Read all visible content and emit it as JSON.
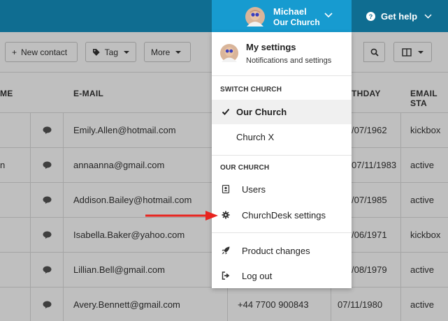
{
  "topbar": {
    "user_name": "Michael",
    "church_name": "Our Church",
    "help_label": "Get help",
    "colors": {
      "bar": "#0f6d91",
      "user_box": "#179bd0"
    }
  },
  "toolbar": {
    "new_contact": "New contact",
    "tag": "Tag",
    "more": "More"
  },
  "table": {
    "headers": {
      "name_partial": "ME",
      "email": "E-MAIL",
      "birthday_partial": "THDAY",
      "email_status_partial": "EMAIL STA"
    },
    "rows": [
      {
        "name": "",
        "email": "Emily.Allen@hotmail.com",
        "phone": "",
        "birthday": "/07/1962",
        "status": "kickbox"
      },
      {
        "name": "n",
        "email": "annaanna@gmail.com",
        "phone": "",
        "birthday": "07/11/1983",
        "status": "active"
      },
      {
        "name": "",
        "email": "Addison.Bailey@hotmail.com",
        "phone": "",
        "birthday": "/07/1985",
        "status": "active"
      },
      {
        "name": "",
        "email": "Isabella.Baker@yahoo.com",
        "phone": "",
        "birthday": "/06/1971",
        "status": "kickbox"
      },
      {
        "name": "",
        "email": "Lillian.Bell@gmail.com",
        "phone": "",
        "birthday": "/08/1979",
        "status": "active"
      },
      {
        "name": "",
        "email": "Avery.Bennett@gmail.com",
        "phone": "+44 7700 900843",
        "birthday": "07/11/1980",
        "status": "active"
      }
    ]
  },
  "menu": {
    "my_settings": "My settings",
    "my_settings_sub": "Notifications and settings",
    "switch_church_header": "SWITCH CHURCH",
    "switch_items": [
      "Our Church",
      "Church X"
    ],
    "our_church_header": "OUR CHURCH",
    "users": "Users",
    "churchdesk_settings": "ChurchDesk settings",
    "product_changes": "Product changes",
    "log_out": "Log out"
  },
  "annotation": {
    "arrow_color": "#e8231e"
  }
}
